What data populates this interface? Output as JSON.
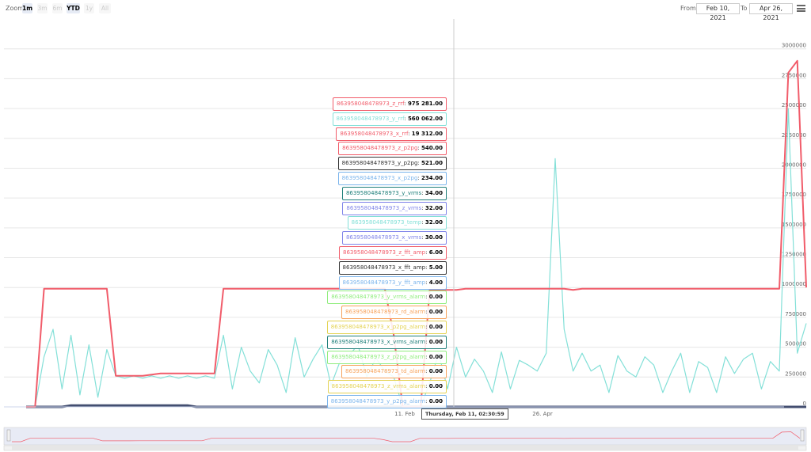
{
  "toolbar": {
    "zoom_label": "Zoom",
    "buttons": [
      {
        "label": "1m",
        "active": true
      },
      {
        "label": "3m",
        "active": false
      },
      {
        "label": "6m",
        "active": false
      },
      {
        "label": "YTD",
        "active": true
      },
      {
        "label": "1y",
        "active": false
      },
      {
        "label": "All",
        "active": false
      }
    ],
    "from_label": "From",
    "from_value": "Feb 10, 2021",
    "to_label": "To",
    "to_value": "Apr 26, 2021",
    "menu_icon": "hamburger-menu-icon"
  },
  "chart_data": {
    "type": "line",
    "x_tick_labels": [
      "11. Feb",
      "26. Apr"
    ],
    "y_tick_labels": [
      "0",
      "250000",
      "500000",
      "750000",
      "1000000",
      "1250000",
      "1500000",
      "1750000",
      "2000000",
      "2250000",
      "2500000",
      "2750000",
      "3000000"
    ],
    "ylim": [
      0,
      3250000
    ],
    "grid": true,
    "colors": {
      "red": "#f15c6a",
      "cyan": "#84e0d8",
      "blue": "#434e70"
    },
    "series": [
      {
        "name": "863958048478973_z_rrf",
        "color": "#f15c6a",
        "values": [
          0,
          0,
          990000,
          990000,
          990000,
          990000,
          990000,
          990000,
          990000,
          990000,
          260000,
          260000,
          260000,
          260000,
          270000,
          280000,
          280000,
          280000,
          280000,
          280000,
          280000,
          280000,
          990000,
          990000,
          990000,
          990000,
          990000,
          990000,
          990000,
          990000,
          990000,
          990000,
          990000,
          990000,
          990000,
          990000,
          990000,
          990000,
          990000,
          990000,
          990000,
          600000,
          0,
          0,
          0,
          980000,
          980000,
          980000,
          980000,
          990000,
          990000,
          990000,
          990000,
          990000,
          990000,
          990000,
          990000,
          990000,
          990000,
          990000,
          990000,
          980000,
          990000,
          990000,
          990000,
          990000,
          990000,
          990000,
          990000,
          990000,
          990000,
          990000,
          990000,
          990000,
          990000,
          990000,
          990000,
          990000,
          990000,
          990000,
          990000,
          990000,
          990000,
          990000,
          990000,
          2800000,
          2900000,
          1000000
        ]
      },
      {
        "name": "863958048478973_y_rrf",
        "color": "#84e0d8",
        "values": [
          0,
          0,
          420000,
          650000,
          150000,
          600000,
          100000,
          520000,
          80000,
          480000,
          260000,
          240000,
          260000,
          240000,
          260000,
          240000,
          260000,
          240000,
          260000,
          240000,
          260000,
          240000,
          600000,
          150000,
          500000,
          300000,
          200000,
          480000,
          350000,
          120000,
          580000,
          250000,
          400000,
          520000,
          180000,
          380000,
          430000,
          520000,
          250000,
          410000,
          300000,
          250000,
          0,
          0,
          0,
          200000,
          450000,
          150000,
          500000,
          250000,
          400000,
          300000,
          120000,
          460000,
          150000,
          390000,
          350000,
          300000,
          450000,
          2080000,
          650000,
          300000,
          450000,
          300000,
          350000,
          120000,
          430000,
          300000,
          250000,
          420000,
          350000,
          120000,
          300000,
          450000,
          120000,
          380000,
          330000,
          120000,
          420000,
          280000,
          400000,
          450000,
          150000,
          380000,
          300000,
          2500000,
          450000,
          700000
        ]
      },
      {
        "name": "863958048478973_x_rrf",
        "color": "#434e70",
        "values": [
          0,
          0,
          0,
          0,
          0,
          12000,
          12000,
          12000,
          12000,
          12000,
          12000,
          12000,
          12000,
          12000,
          12000,
          12000,
          12000,
          12000,
          12000,
          0,
          0,
          0,
          0,
          0,
          0,
          0,
          0,
          0,
          0,
          0,
          0,
          0,
          0,
          0,
          0,
          0,
          0,
          0,
          0,
          0,
          0,
          0,
          0,
          0,
          0,
          0,
          0,
          0,
          0,
          0,
          0,
          0,
          0,
          0,
          0,
          0,
          0,
          0,
          0,
          0,
          0,
          0,
          0,
          0,
          0,
          0,
          0,
          0,
          0,
          0,
          0,
          0,
          0,
          0,
          0,
          0,
          0,
          0,
          0,
          0,
          0,
          0,
          0,
          0,
          0,
          0,
          0,
          0
        ]
      }
    ],
    "tooltip": {
      "header": "Thursday, Feb 11, 02:30:59",
      "items": [
        {
          "name": "863958048478973_z_rrf",
          "value": "975 281.00",
          "color": "#f15c6a"
        },
        {
          "name": "863958048478973_y_rrf",
          "value": "560 062.00",
          "color": "#84e0d8"
        },
        {
          "name": "863958048478973_x_rrf",
          "value": "19 312.00",
          "color": "#f15c6a"
        },
        {
          "name": "863958048478973_z_p2pg",
          "value": "540.00",
          "color": "#f15c6a"
        },
        {
          "name": "863958048478973_y_p2pg",
          "value": "521.00",
          "color": "#333333"
        },
        {
          "name": "863958048478973_x_p2pg",
          "value": "234.00",
          "color": "#7cb5ec"
        },
        {
          "name": "863958048478973_y_vrms",
          "value": "34.00",
          "color": "#1f7f7a"
        },
        {
          "name": "863958048478973_z_vrms",
          "value": "32.00",
          "color": "#8085e9"
        },
        {
          "name": "863958048478973_temp",
          "value": "32.00",
          "color": "#84e0d8"
        },
        {
          "name": "863958048478973_x_vrms",
          "value": "30.00",
          "color": "#8085e9"
        },
        {
          "name": "863958048478973_z_fft_amp",
          "value": "6.00",
          "color": "#f15c6a"
        },
        {
          "name": "863958048478973_x_fft_amp",
          "value": "5.00",
          "color": "#333333"
        },
        {
          "name": "863958048478973_y_fft_amp",
          "value": "4.00",
          "color": "#7cb5ec"
        },
        {
          "name": "863958048478973_y_vrms_alarm",
          "value": "0.00",
          "color": "#90ed7d"
        },
        {
          "name": "863958048478973_rd_alarm",
          "value": "0.00",
          "color": "#f7a35c"
        },
        {
          "name": "863958048478973_x_p2pg_alarm",
          "value": "0.00",
          "color": "#e4d354"
        },
        {
          "name": "863958048478973_x_vrms_alarm",
          "value": "0.00",
          "color": "#1f7f7a"
        },
        {
          "name": "863958048478973_z_p2pg_alarm",
          "value": "0.00",
          "color": "#90ed7d"
        },
        {
          "name": "863958048478973_td_alarm",
          "value": "0.00",
          "color": "#f7a35c"
        },
        {
          "name": "863958048478973_z_vrms_alarm",
          "value": "0.00",
          "color": "#e4d354"
        },
        {
          "name": "863958048478973_y_p2pg_alarm",
          "value": "0.00",
          "color": "#7cb5ec"
        }
      ]
    }
  }
}
